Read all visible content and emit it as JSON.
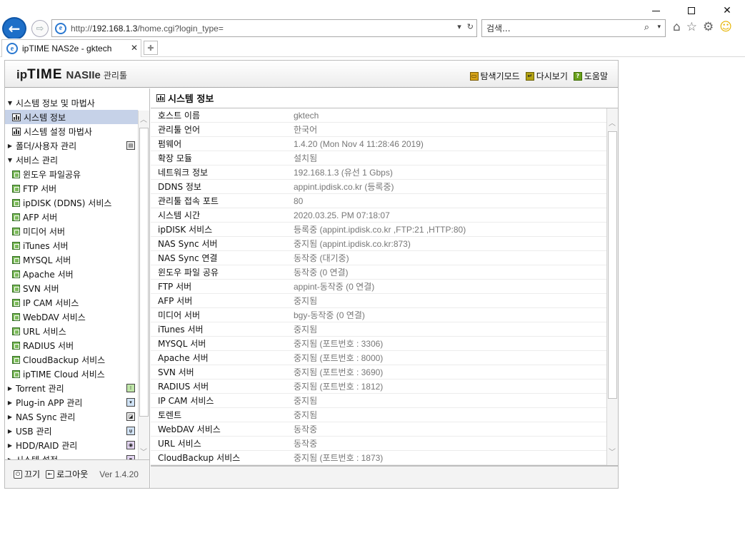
{
  "browser": {
    "address_prefix": "http://",
    "address_host": "192.168.1.3",
    "address_path": "/home.cgi?login_type=",
    "search_placeholder": "검색...",
    "tab_title": "ipTIME NAS2e - gktech"
  },
  "app": {
    "logo_ip": "ip",
    "logo_time": "TIME",
    "logo_model": "NASIIe",
    "logo_sub": "관리툴",
    "header_links": [
      "탐색기모드",
      "다시보기",
      "도움말"
    ]
  },
  "sidebar": {
    "items": [
      {
        "label": "시스템 정보 및 마법사",
        "type": "top",
        "expanded": true
      },
      {
        "label": "시스템 정보",
        "type": "sub",
        "selected": true
      },
      {
        "label": "시스템 설정 마법사",
        "type": "sub"
      },
      {
        "label": "폴더/사용자 관리",
        "type": "top",
        "expanded": false,
        "right_icon": "folder-user-icon"
      },
      {
        "label": "서비스 관리",
        "type": "top",
        "expanded": true
      },
      {
        "label": "윈도우 파일공유",
        "type": "svc"
      },
      {
        "label": "FTP 서버",
        "type": "svc"
      },
      {
        "label": "ipDISK (DDNS) 서비스",
        "type": "svc"
      },
      {
        "label": "AFP 서버",
        "type": "svc"
      },
      {
        "label": "미디어 서버",
        "type": "svc"
      },
      {
        "label": "iTunes 서버",
        "type": "svc"
      },
      {
        "label": "MYSQL 서버",
        "type": "svc"
      },
      {
        "label": "Apache 서버",
        "type": "svc"
      },
      {
        "label": "SVN 서버",
        "type": "svc"
      },
      {
        "label": "IP CAM 서비스",
        "type": "svc"
      },
      {
        "label": "WebDAV 서비스",
        "type": "svc"
      },
      {
        "label": "URL 서비스",
        "type": "svc"
      },
      {
        "label": "RADIUS 서버",
        "type": "svc"
      },
      {
        "label": "CloudBackup 서비스",
        "type": "svc"
      },
      {
        "label": "ipTIME Cloud 서비스",
        "type": "svc"
      },
      {
        "label": "Torrent 관리",
        "type": "top",
        "expanded": false,
        "right_icon": "torrent-icon"
      },
      {
        "label": "Plug-in APP 관리",
        "type": "top",
        "expanded": false,
        "right_icon": "plugin-icon"
      },
      {
        "label": "NAS Sync 관리",
        "type": "top",
        "expanded": false,
        "right_icon": "sync-icon"
      },
      {
        "label": "USB 관리",
        "type": "top",
        "expanded": false,
        "right_icon": "usb-icon"
      },
      {
        "label": "HDD/RAID 관리",
        "type": "top",
        "expanded": false,
        "right_icon": "hdd-icon"
      },
      {
        "label": "시스템 설정",
        "type": "top",
        "expanded": false,
        "right_icon": "settings-icon"
      }
    ],
    "footer": {
      "power_label": "끄기",
      "logout_label": "로그아웃",
      "version": "Ver 1.4.20"
    }
  },
  "content": {
    "title": "시스템 정보",
    "rows": [
      {
        "key": "호스트 이름",
        "value": "gktech"
      },
      {
        "key": "관리툴 언어",
        "value": "한국어"
      },
      {
        "key": "펌웨어",
        "value": "1.4.20 (Mon Nov 4 11:28:46 2019)"
      },
      {
        "key": "확장 모듈",
        "value": "설치됨"
      },
      {
        "key": "네트워크 정보",
        "value": "192.168.1.3 (유선 1 Gbps)"
      },
      {
        "key": "DDNS 정보",
        "value": "appint.ipdisk.co.kr (등록중)"
      },
      {
        "key": "관리툴 접속 포트",
        "value": "80"
      },
      {
        "key": "시스템 시간",
        "value": "2020.03.25. PM 07:18:07"
      },
      {
        "key": "ipDISK 서비스",
        "value": "등록중 (appint.ipdisk.co.kr ,FTP:21 ,HTTP:80)"
      },
      {
        "key": "NAS Sync 서버",
        "value": "중지됨 (appint.ipdisk.co.kr:873)"
      },
      {
        "key": "NAS Sync 연결",
        "value": "동작중 (대기중)"
      },
      {
        "key": "윈도우 파일 공유",
        "value": "동작중 (0 연결)"
      },
      {
        "key": "FTP 서버",
        "value": "appint-동작중 (0 연결)"
      },
      {
        "key": "AFP 서버",
        "value": "중지됨"
      },
      {
        "key": "미디어 서버",
        "value": "bgy-동작중 (0 연결)"
      },
      {
        "key": "iTunes 서버",
        "value": "중지됨"
      },
      {
        "key": "MYSQL 서버",
        "value": "중지됨 (포트번호 : 3306)"
      },
      {
        "key": "Apache 서버",
        "value": "중지됨 (포트번호 : 8000)"
      },
      {
        "key": "SVN 서버",
        "value": "중지됨 (포트번호 : 3690)"
      },
      {
        "key": "RADIUS 서버",
        "value": "중지됨 (포트번호 : 1812)"
      },
      {
        "key": "IP CAM 서비스",
        "value": "중지됨"
      },
      {
        "key": "토렌트",
        "value": "중지됨"
      },
      {
        "key": "WebDAV 서비스",
        "value": "동작중"
      },
      {
        "key": "URL 서비스",
        "value": "동작중"
      },
      {
        "key": "CloudBackup 서비스",
        "value": "중지됨 (포트번호 : 1873)"
      }
    ]
  }
}
